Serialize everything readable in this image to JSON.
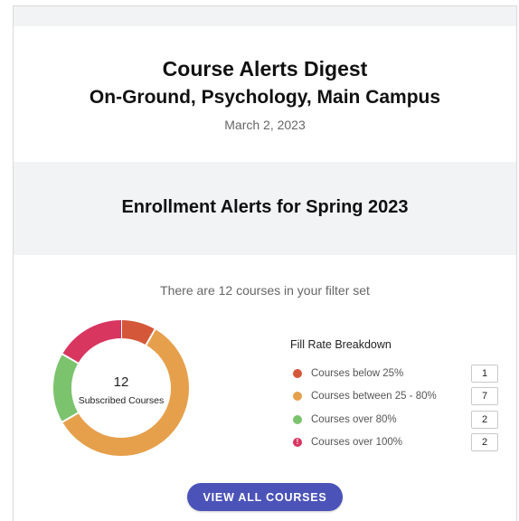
{
  "header": {
    "title": "Course Alerts Digest",
    "subtitle": "On-Ground, Psychology, Main Campus",
    "date": "March 2, 2023"
  },
  "section": {
    "title": "Enrollment Alerts for Spring 2023"
  },
  "summary": {
    "intro": "There are 12 courses in your filter set",
    "total": "12",
    "total_label": "Subscribed Courses"
  },
  "legend": {
    "title": "Fill Rate Breakdown",
    "items": [
      {
        "label": "Courses below 25%",
        "count": "1",
        "color": "#d4573a",
        "icon": "dot"
      },
      {
        "label": "Courses between 25 - 80%",
        "count": "7",
        "color": "#e6a04c",
        "icon": "dot"
      },
      {
        "label": "Courses over 80%",
        "count": "2",
        "color": "#7cc36e",
        "icon": "dot"
      },
      {
        "label": "Courses over 100%",
        "count": "2",
        "color": "#d8355f",
        "icon": "exclamation-dot"
      }
    ]
  },
  "chart_data": {
    "type": "pie",
    "donut": true,
    "categories": [
      "Courses below 25%",
      "Courses between 25 - 80%",
      "Courses over 80%",
      "Courses over 100%"
    ],
    "values": [
      1,
      7,
      2,
      2
    ],
    "colors": [
      "#d4573a",
      "#e6a04c",
      "#7cc36e",
      "#d8355f"
    ]
  },
  "actions": {
    "view_all": "VIEW ALL COURSES",
    "button_color": "#4b53b9"
  }
}
